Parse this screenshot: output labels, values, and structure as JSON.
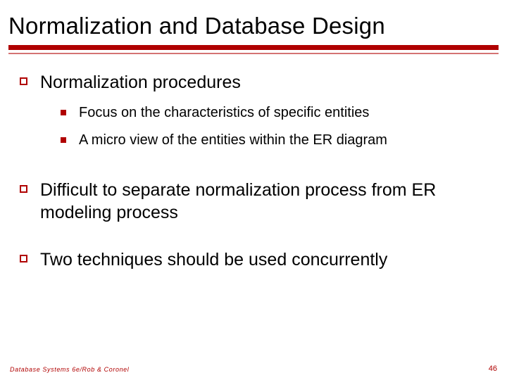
{
  "title": "Normalization and Database Design",
  "items": [
    {
      "text": "Normalization procedures",
      "sub": [
        "Focus on the characteristics of specific entities",
        "A micro view of the entities within the ER diagram"
      ]
    },
    {
      "text": "Difficult to separate normalization process from ER modeling process",
      "sub": []
    },
    {
      "text": "Two techniques should be used concurrently",
      "sub": []
    }
  ],
  "footer": {
    "source": "Database Systems 6e/Rob & Coronel",
    "page": "46"
  }
}
